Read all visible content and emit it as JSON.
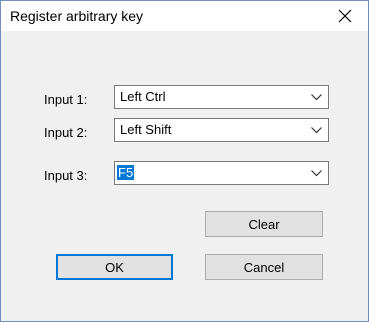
{
  "window": {
    "title": "Register arbitrary key"
  },
  "inputs": [
    {
      "label": "Input 1:",
      "value": "Left Ctrl"
    },
    {
      "label": "Input 2:",
      "value": "Left Shift"
    },
    {
      "label": "Input 3:",
      "value": "F5",
      "selected": true
    }
  ],
  "buttons": {
    "clear": "Clear",
    "ok": "OK",
    "cancel": "Cancel"
  },
  "colors": {
    "accent": "#0078d7",
    "dialog_background": "#f0f0f0",
    "button_background": "#e1e1e1"
  },
  "icons": {
    "close": "close-icon",
    "dropdown": "chevron-down-icon"
  }
}
